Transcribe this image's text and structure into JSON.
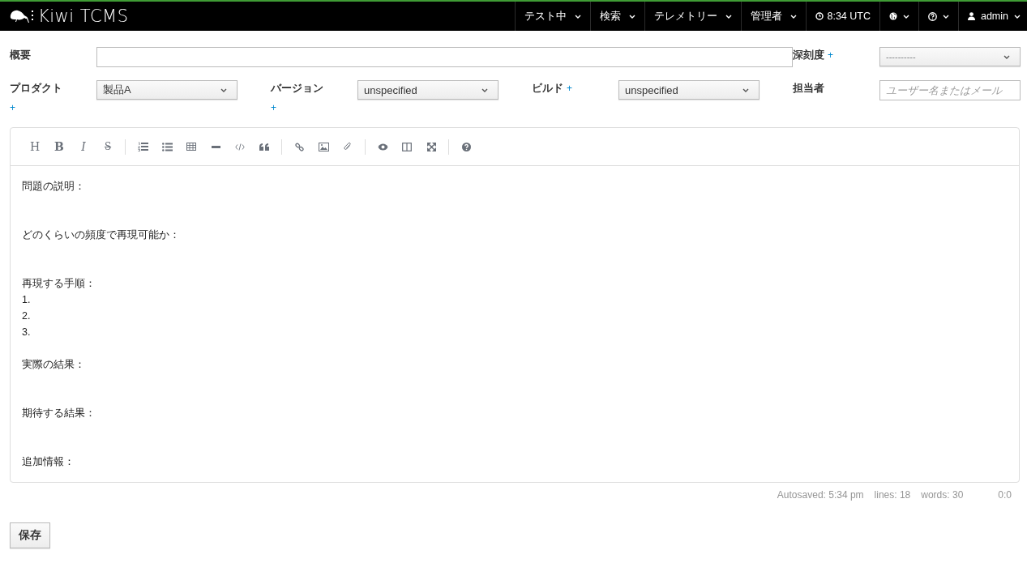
{
  "navbar": {
    "brand": "Kiwi TCMS",
    "items": [
      {
        "kind": "menu",
        "label": "テスト中"
      },
      {
        "kind": "menu",
        "label": "検索"
      },
      {
        "kind": "menu",
        "label": "テレメトリー"
      },
      {
        "kind": "menu",
        "label": "管理者"
      },
      {
        "kind": "clock",
        "label": "8:34 UTC"
      },
      {
        "kind": "globe"
      },
      {
        "kind": "help"
      },
      {
        "kind": "user",
        "label": "admin"
      }
    ]
  },
  "form": {
    "summary": {
      "label": "概要"
    },
    "severity": {
      "label": "深刻度",
      "add": "+",
      "placeholder": "----------"
    },
    "product": {
      "label": "プロダクト",
      "add": "+",
      "value": "製品A"
    },
    "version": {
      "label": "バージョン",
      "add": "+",
      "value": "unspecified"
    },
    "build": {
      "label": "ビルド",
      "add": "+",
      "value": "unspecified"
    },
    "assignee": {
      "label": "担当者",
      "placeholder": "ユーザー名またはメール"
    }
  },
  "editor": {
    "toolbar": [
      [
        {
          "kind": "heading",
          "glyph": "H"
        },
        {
          "kind": "bold",
          "glyph": "B"
        },
        {
          "kind": "italic",
          "glyph": "I"
        },
        {
          "kind": "strike",
          "glyph": "S"
        }
      ],
      [
        {
          "kind": "ordered-list"
        },
        {
          "kind": "bullet-list"
        },
        {
          "kind": "table"
        },
        {
          "kind": "rule"
        },
        {
          "kind": "code"
        },
        {
          "kind": "quote"
        }
      ],
      [
        {
          "kind": "link"
        },
        {
          "kind": "image"
        },
        {
          "kind": "attach"
        }
      ],
      [
        {
          "kind": "preview"
        },
        {
          "kind": "side-by-side"
        },
        {
          "kind": "fullscreen"
        }
      ],
      [
        {
          "kind": "help"
        }
      ]
    ],
    "content": [
      {
        "kind": "heading",
        "text": "問題の説明："
      },
      {
        "kind": "heading",
        "text": "どのくらいの頻度で再現可能か："
      },
      {
        "kind": "heading",
        "text": "再現する手順："
      },
      {
        "kind": "step",
        "text": "1."
      },
      {
        "kind": "step",
        "text": "2."
      },
      {
        "kind": "step",
        "text": "3."
      },
      {
        "kind": "heading",
        "text": "実際の結果："
      },
      {
        "kind": "heading",
        "text": "期待する結果："
      },
      {
        "kind": "heading",
        "text": "追加情報："
      }
    ],
    "status": {
      "autosaved": "Autosaved: 5:34 pm",
      "lines": "lines: 18",
      "words": "words: 30",
      "cursor": "0:0"
    }
  },
  "save_button": "保存"
}
